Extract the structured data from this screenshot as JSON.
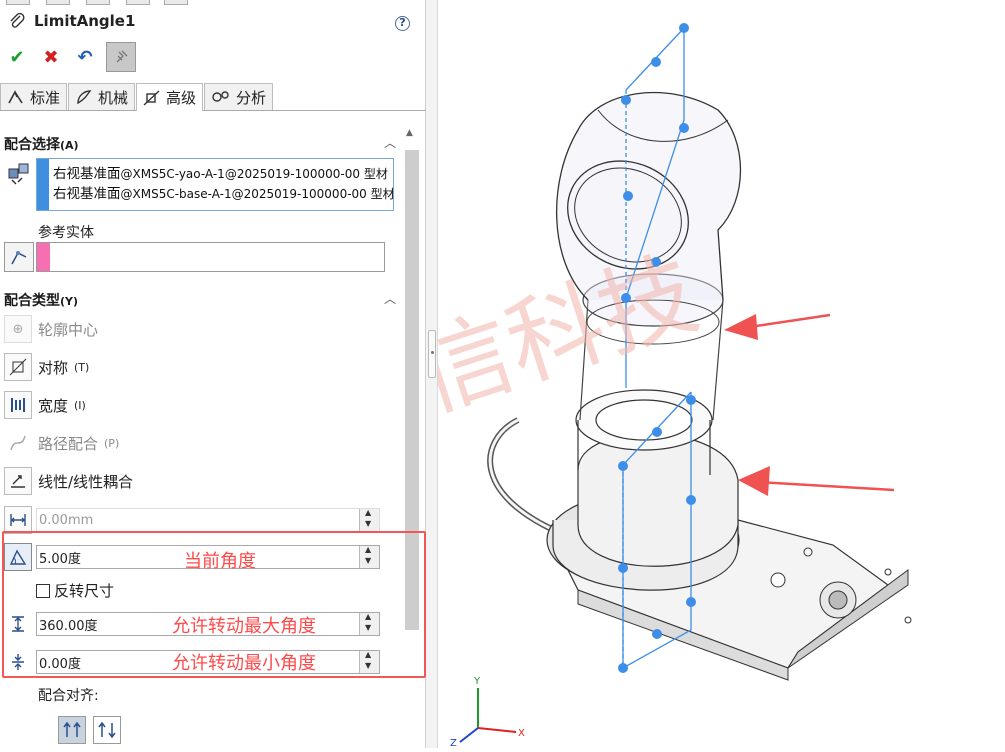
{
  "propertymanager": {
    "title": "LimitAngle1",
    "help": "?",
    "actions": {
      "ok": "✔",
      "cancel": "✖",
      "undo": "↶",
      "pin": "📌"
    },
    "tabs": [
      {
        "label": "标准",
        "icon": "standard-mates-icon"
      },
      {
        "label": "机械",
        "icon": "mechanical-mates-icon"
      },
      {
        "label": "高级",
        "icon": "advanced-mates-icon",
        "active": true
      },
      {
        "label": "分析",
        "icon": "analysis-icon"
      }
    ],
    "mate_selection": {
      "heading": "配合选择",
      "heading_key": "(A)",
      "entities": [
        {
          "main": "右视基准面",
          "detail": "@XMS5C-yao-A-1@2025019-100000-00 型材"
        },
        {
          "main": "右视基准面",
          "detail": "@XMS5C-base-A-1@2025019-100000-00 型材"
        }
      ],
      "reference_label": "参考实体"
    },
    "mate_types": {
      "heading": "配合类型",
      "heading_key": "(Y)",
      "items": [
        {
          "label": "轮廓中心",
          "key": "",
          "enabled": false,
          "icon": "profile-center-icon"
        },
        {
          "label": "对称",
          "key": "(T)",
          "enabled": true,
          "icon": "symmetric-icon"
        },
        {
          "label": "宽度",
          "key": "(I)",
          "enabled": true,
          "icon": "width-icon"
        },
        {
          "label": "路径配合",
          "key": "(P)",
          "enabled": false,
          "icon": "path-mate-icon"
        },
        {
          "label": "线性/线性耦合",
          "key": "",
          "enabled": true,
          "icon": "linear-coupler-icon"
        }
      ],
      "distance_value": "0.00mm",
      "angle_value": "5.00度",
      "angle_note": "当前角度",
      "flip_label": "反转尺寸",
      "max_value": "360.00度",
      "max_note": "允许转动最大角度",
      "min_value": "0.00度",
      "min_note": "允许转动最小角度"
    },
    "alignment": {
      "label": "配合对齐:"
    }
  },
  "viewport": {
    "watermark": "生信科技",
    "triad": {
      "x": "X",
      "y": "Y",
      "z": "Z"
    },
    "colors": {
      "plane": "#3d8ee8",
      "arrow": "#f05252",
      "watermark": "#f7c6bf"
    }
  }
}
